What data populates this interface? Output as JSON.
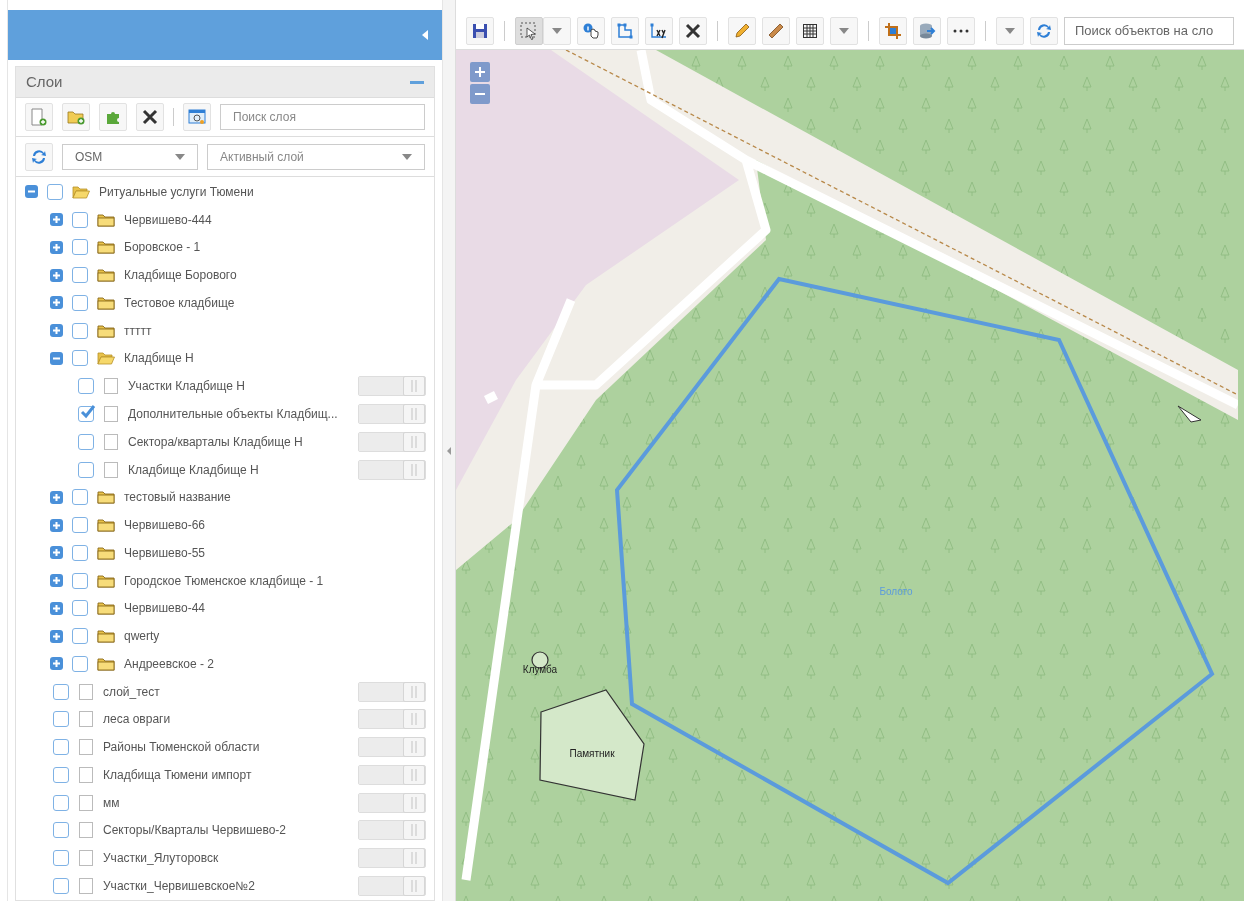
{
  "layers_panel": {
    "title": "Слои",
    "search": {
      "placeholder": "Поиск слоя"
    },
    "basemap_select": {
      "value": "OSM"
    },
    "active_layer_select": {
      "placeholder": "Активный слой"
    },
    "tree": [
      {
        "kind": "folder",
        "label": "Ритуальные услуги Тюмени",
        "expanded": true,
        "checked": false,
        "children": [
          {
            "kind": "folder",
            "label": "Червишево-444",
            "expanded": false,
            "checked": false
          },
          {
            "kind": "folder",
            "label": "Боровское - 1",
            "expanded": false,
            "checked": false
          },
          {
            "kind": "folder",
            "label": "Кладбище Борового",
            "expanded": false,
            "checked": false
          },
          {
            "kind": "folder",
            "label": "Тестовое кладбище",
            "expanded": false,
            "checked": false
          },
          {
            "kind": "folder",
            "label": "ттттт",
            "expanded": false,
            "checked": false
          },
          {
            "kind": "folder",
            "label": "Кладбище Н",
            "expanded": true,
            "checked": false,
            "children": [
              {
                "kind": "layer",
                "label": "Участки Кладбище Н",
                "checked": false,
                "level": 1
              },
              {
                "kind": "layer",
                "label": "Дополнительные объекты Кладбищ...",
                "checked": true,
                "level": 1
              },
              {
                "kind": "layer",
                "label": "Сектора/кварталы Кладбище Н",
                "checked": false,
                "level": 1
              },
              {
                "kind": "layer",
                "label": "Кладбище Кладбище Н",
                "checked": false,
                "level": 1
              }
            ]
          },
          {
            "kind": "folder",
            "label": "тестовый название",
            "expanded": false,
            "checked": false
          },
          {
            "kind": "folder",
            "label": "Червишево-66",
            "expanded": false,
            "checked": false
          },
          {
            "kind": "folder",
            "label": "Червишево-55",
            "expanded": false,
            "checked": false
          },
          {
            "kind": "folder",
            "label": "Городское Тюменское кладбище - 1",
            "expanded": false,
            "checked": false
          },
          {
            "kind": "folder",
            "label": "Червишево-44",
            "expanded": false,
            "checked": false
          },
          {
            "kind": "folder",
            "label": "qwerty",
            "expanded": false,
            "checked": false
          },
          {
            "kind": "folder",
            "label": "Андреевское - 2",
            "expanded": false,
            "checked": false
          },
          {
            "kind": "layer",
            "label": "слой_тест",
            "checked": false,
            "level": 1
          },
          {
            "kind": "layer",
            "label": "леса овраги",
            "checked": false,
            "level": 1
          },
          {
            "kind": "layer",
            "label": "Районы Тюменской области",
            "checked": false,
            "level": 1
          },
          {
            "kind": "layer",
            "label": "Кладбища Тюмени импорт",
            "checked": false,
            "level": 1
          },
          {
            "kind": "layer",
            "label": "мм",
            "checked": false,
            "level": 1
          },
          {
            "kind": "layer",
            "label": "Секторы/Кварталы Червишево-2",
            "checked": false,
            "level": 1
          },
          {
            "kind": "layer",
            "label": "Участки_Ялуторовск",
            "checked": false,
            "level": 1
          },
          {
            "kind": "layer",
            "label": "Участки_Червишевское№2",
            "checked": false,
            "level": 1
          }
        ]
      }
    ]
  },
  "map_toolbar": {
    "selection_active": true,
    "search": {
      "placeholder": "Поиск объектов на сло"
    }
  },
  "map": {
    "labels": {
      "swamp": "Болото",
      "flowerbed": "Клумба",
      "monument": "Памятник"
    }
  }
}
